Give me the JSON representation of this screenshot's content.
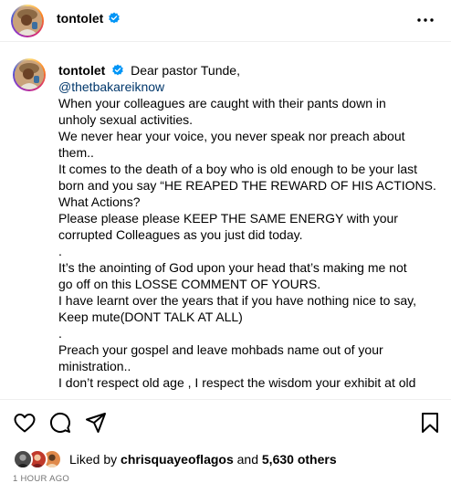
{
  "post": {
    "username": "tontolet",
    "verified": true,
    "more_icon": "ellipsis-horizontal-icon"
  },
  "caption": {
    "username": "tontolet",
    "lines": [
      "Dear pastor Tunde,",
      "@thetbakareiknow",
      "When your colleagues are caught with their pants down in",
      "unholy sexual activities.",
      "We never hear your voice, you never speak nor preach about",
      "them..",
      "It comes to the death of a boy who is old enough to be your last",
      "born and you say “HE REAPED THE REWARD OF HIS ACTIONS.",
      "What Actions?",
      "Please please please KEEP THE SAME ENERGY with your",
      "corrupted Colleagues as you just did today.",
      ".",
      "It’s the anointing of God upon your head that’s making me not",
      "go off on this LOSSE COMMENT OF YOURS.",
      "I have learnt over the years that if you have nothing nice to say,",
      "Keep mute(DONT TALK AT ALL)",
      ".",
      "Preach your gospel and leave mohbads name out of your",
      "ministration..",
      "I don’t respect old age , I respect the wisdom your exhibit at old"
    ]
  },
  "actions": {
    "like_icon": "heart-icon",
    "comment_icon": "comment-icon",
    "share_icon": "paper-plane-icon",
    "save_icon": "bookmark-icon"
  },
  "likes": {
    "prefix": "Liked by",
    "user": "chrisquayeoflagos",
    "conjunction": "and",
    "others": "5,630 others"
  },
  "timestamp": "1 HOUR AGO",
  "colors": {
    "verified_blue": "#0095f6",
    "mention_blue": "#00376b",
    "muted_gray": "#737373"
  }
}
